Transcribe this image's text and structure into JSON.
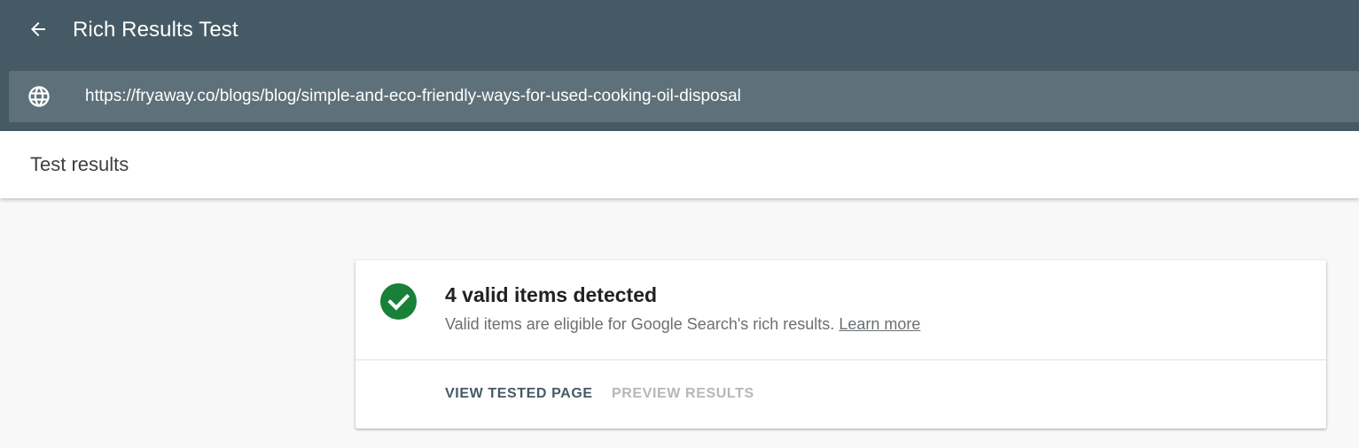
{
  "header": {
    "title": "Rich Results Test",
    "back_icon": "arrow-left-icon",
    "background": "#455a64"
  },
  "url_bar": {
    "icon": "globe-icon",
    "value": "https://fryaway.co/blogs/blog/simple-and-eco-friendly-ways-for-used-cooking-oil-disposal"
  },
  "subheader": {
    "title": "Test results"
  },
  "result": {
    "icon": "check-circle-icon",
    "status_color": "#188038",
    "title": "4 valid items detected",
    "description": "Valid items are eligible for Google Search's rich results.",
    "learn_more": "Learn more",
    "actions": {
      "view_tested_page": "VIEW TESTED PAGE",
      "preview_results": "PREVIEW RESULTS"
    }
  }
}
